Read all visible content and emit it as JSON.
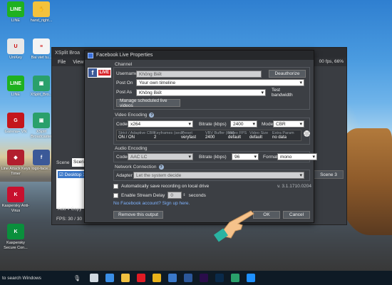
{
  "desktop": {
    "icons": [
      {
        "label": "LINE",
        "color": "#1fb11f",
        "glyph": "LINE"
      },
      {
        "label": "hand_right...",
        "color": "#f3c23c",
        "glyph": "✋"
      },
      {
        "label": "UniKey",
        "color": "#e8e8e8",
        "glyph": "U"
      },
      {
        "label": "Bai viet tu...",
        "color": "#f4f4f4",
        "glyph": "≡"
      },
      {
        "label": "LINE",
        "color": "#1fb11f",
        "glyph": "LINE"
      },
      {
        "label": "XSplit_Bro...",
        "color": "#2aa06b",
        "glyph": "▣"
      },
      {
        "label": "Garena+ VN",
        "color": "#c4161c",
        "glyph": "G"
      },
      {
        "label": "XSplit Broadcaster",
        "color": "#2aa06b",
        "glyph": "▣"
      },
      {
        "label": "Line Attack Keys Timer",
        "color": "#b21f2e",
        "glyph": "◆"
      },
      {
        "label": "logo-face...",
        "color": "#3b5998",
        "glyph": "f"
      },
      {
        "label": "Kaspersky Anti-Virus",
        "color": "#c8102e",
        "glyph": "K"
      },
      {
        "label": "Kaspersky Secure Con...",
        "color": "#0a8f3c",
        "glyph": "K"
      }
    ]
  },
  "xsplit": {
    "title": "XSplit Broa",
    "menu": [
      "File",
      "View"
    ],
    "stats": "00 fps, 66%",
    "scene_label": "Scene",
    "scene_value": "Scene",
    "source_item": "Desktop 1",
    "add_label": "Add",
    "copy_label": "Copy",
    "fps_label": "FPS:  30 / 30",
    "scene3": "Scene 3"
  },
  "dialog": {
    "title": "Facebook Live Properties",
    "live_badge": "LIVE",
    "channel": {
      "section_title": "Channel",
      "username_label": "Username",
      "username_value": "Không Biết",
      "deauthorize_button": "Deauthorize",
      "post_on_label": "Post On",
      "post_on_value": "Your own timeline",
      "post_as_label": "Post As",
      "post_as_value": "Không Biết",
      "test_bandwidth_button": "Test bandwidth",
      "manage_button": "Manage scheduled live videos"
    },
    "video": {
      "section_title": "Video Encoding",
      "codec_label": "Codec",
      "codec_value": "x264",
      "bitrate_label": "Bitrate (kbps)",
      "bitrate_value": "2400",
      "mode_label": "Mode",
      "mode_value": "CBR",
      "stats": [
        {
          "head": "Strict / Adaptive CBR",
          "value": "ON / ON"
        },
        {
          "head": "Keyframes (secs)",
          "value": "2"
        },
        {
          "head": "Preset",
          "value": "veryfast"
        },
        {
          "head": "VBV Buffer (kbit)",
          "value": "2400"
        },
        {
          "head": "Video FPS",
          "value": "default"
        },
        {
          "head": "Video Size",
          "value": "default"
        },
        {
          "head": "Extra Param",
          "value": "no data"
        }
      ]
    },
    "audio": {
      "section_title": "Audio Encoding",
      "codec_label": "Codec",
      "codec_value": "AAC LC",
      "bitrate_label": "Bitrate (kbps)",
      "bitrate_value": "96",
      "format_label": "Format",
      "format_value": "mono"
    },
    "network": {
      "section_title": "Network Connection",
      "adapter_label": "Adapter",
      "adapter_value": "Let the system decide"
    },
    "options": {
      "auto_save_label": "Automatically save recording on local drive",
      "stream_delay_label": "Enable Stream Delay",
      "stream_delay_value": "0",
      "seconds_label": "seconds",
      "version": "v. 3.1.1710.0204",
      "no_account_link": "No Facebook account? Sign up here."
    },
    "remove_button": "Remove this output",
    "ok_button": "OK",
    "cancel_button": "Cancel"
  },
  "taskbar": {
    "search_text": "to search Windows",
    "apps": [
      {
        "name": "task-view-icon",
        "color": "#cfd8e0"
      },
      {
        "name": "edge-icon",
        "color": "#3a8ee6"
      },
      {
        "name": "file-explorer-icon",
        "color": "#f0c040"
      },
      {
        "name": "opera-icon",
        "color": "#e01b24"
      },
      {
        "name": "chrome-icon",
        "color": "#e8b21a"
      },
      {
        "name": "store-icon",
        "color": "#3a78c9"
      },
      {
        "name": "word-icon",
        "color": "#2b579a"
      },
      {
        "name": "premiere-icon",
        "color": "#2a0d4a"
      },
      {
        "name": "photoshop-icon",
        "color": "#0a2a4a"
      },
      {
        "name": "xsplit-icon",
        "color": "#2aa06b"
      },
      {
        "name": "ie-icon",
        "color": "#1e90ff"
      }
    ]
  }
}
